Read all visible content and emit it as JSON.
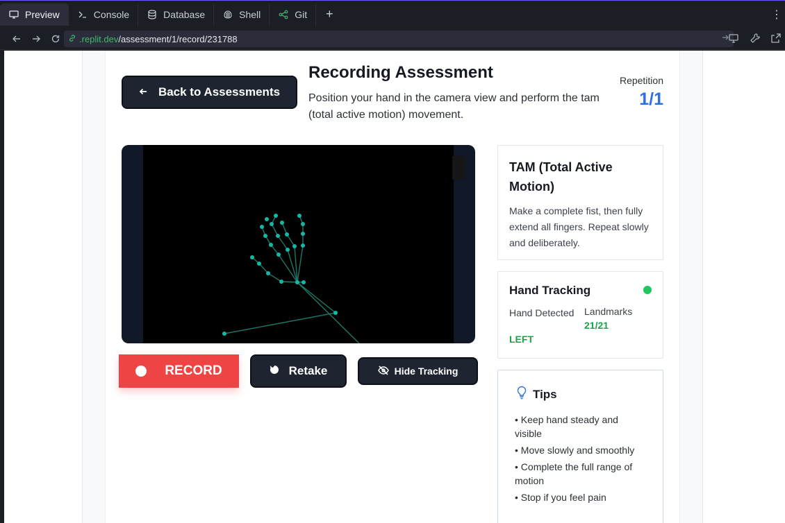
{
  "tabs": [
    {
      "label": "Preview",
      "icon": "monitor-icon"
    },
    {
      "label": "Console",
      "icon": "terminal-icon"
    },
    {
      "label": "Database",
      "icon": "database-icon"
    },
    {
      "label": "Shell",
      "icon": "shell-icon"
    },
    {
      "label": "Git",
      "icon": "git-icon"
    }
  ],
  "browser": {
    "url_host": ".replit.dev",
    "url_path": "/assessment/1/record/231788"
  },
  "page": {
    "back_label": "Back to Assessments",
    "title": "Recording Assessment",
    "description": "Position your hand in the camera view and perform the tam (total active motion) movement.",
    "repetition_label": "Repetition",
    "repetition_value": "1/1"
  },
  "controls": {
    "record_label": "RECORD",
    "retake_label": "Retake",
    "hide_tracking_label": "Hide Tracking"
  },
  "exercise": {
    "title": "TAM (Total Active Motion)",
    "description": "Make a complete fist, then fully extend all fingers. Repeat slowly and deliberately."
  },
  "tracking": {
    "title": "Hand Tracking",
    "hand_label": "Hand Detected",
    "hand_value": "LEFT",
    "landmarks_label": "Landmarks",
    "landmarks_value": "21/21",
    "status_color": "#22c55e"
  },
  "tips": {
    "title": "Tips",
    "items": [
      "Keep hand steady and visible",
      "Move slowly and smoothly",
      "Complete the full range of motion",
      "Stop if you feel pain"
    ]
  },
  "colors": {
    "accent": "#2f6fe0",
    "record": "#ef4444",
    "success": "#16a34a",
    "landmark": "#14b8a6"
  }
}
